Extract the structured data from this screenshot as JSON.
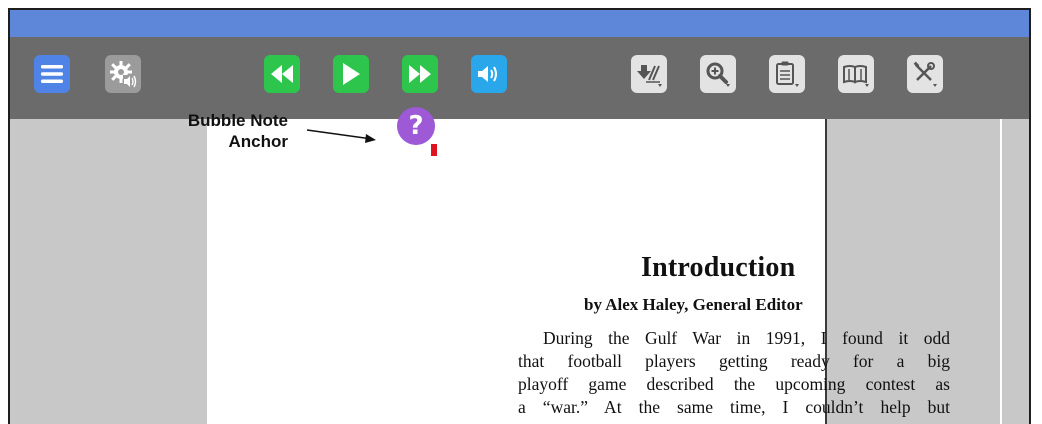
{
  "toolbar": {
    "buttons": [
      {
        "id": "menu",
        "icon": "hamburger-menu-icon",
        "color": "#4f84e6"
      },
      {
        "id": "speech-settings",
        "icon": "gear-speaker-icon",
        "color": "#9b9b9b"
      },
      {
        "id": "rewind",
        "icon": "rewind-icon",
        "color": "#2ec54d"
      },
      {
        "id": "play",
        "icon": "play-icon",
        "color": "#2ec54d"
      },
      {
        "id": "fast-forward",
        "icon": "fast-forward-icon",
        "color": "#2ec54d"
      },
      {
        "id": "volume",
        "icon": "volume-icon",
        "color": "#2aa6ea"
      },
      {
        "id": "highlighters",
        "icon": "highlighter-icon",
        "color": "#e3e3e3"
      },
      {
        "id": "zoom",
        "icon": "zoom-in-icon",
        "color": "#e3e3e3"
      },
      {
        "id": "notes",
        "icon": "clipboard-icon",
        "color": "#e3e3e3"
      },
      {
        "id": "reference",
        "icon": "book-icon",
        "color": "#e3e3e3"
      },
      {
        "id": "tools",
        "icon": "tools-icon",
        "color": "#e3e3e3"
      }
    ]
  },
  "annotation": {
    "line1": "Bubble Note",
    "line2": "Anchor"
  },
  "bubble_note": {
    "symbol": "?",
    "color": "#9d59d6"
  },
  "document": {
    "title": "Introduction",
    "byline": "by Alex Haley, General Editor",
    "paragraph_lines": [
      "During the Gulf War in 1991, I found it odd",
      "that football players getting ready for a big",
      "playoff game described the upcoming contest as",
      "a “war.” At the same time, I couldn’t help but"
    ]
  }
}
